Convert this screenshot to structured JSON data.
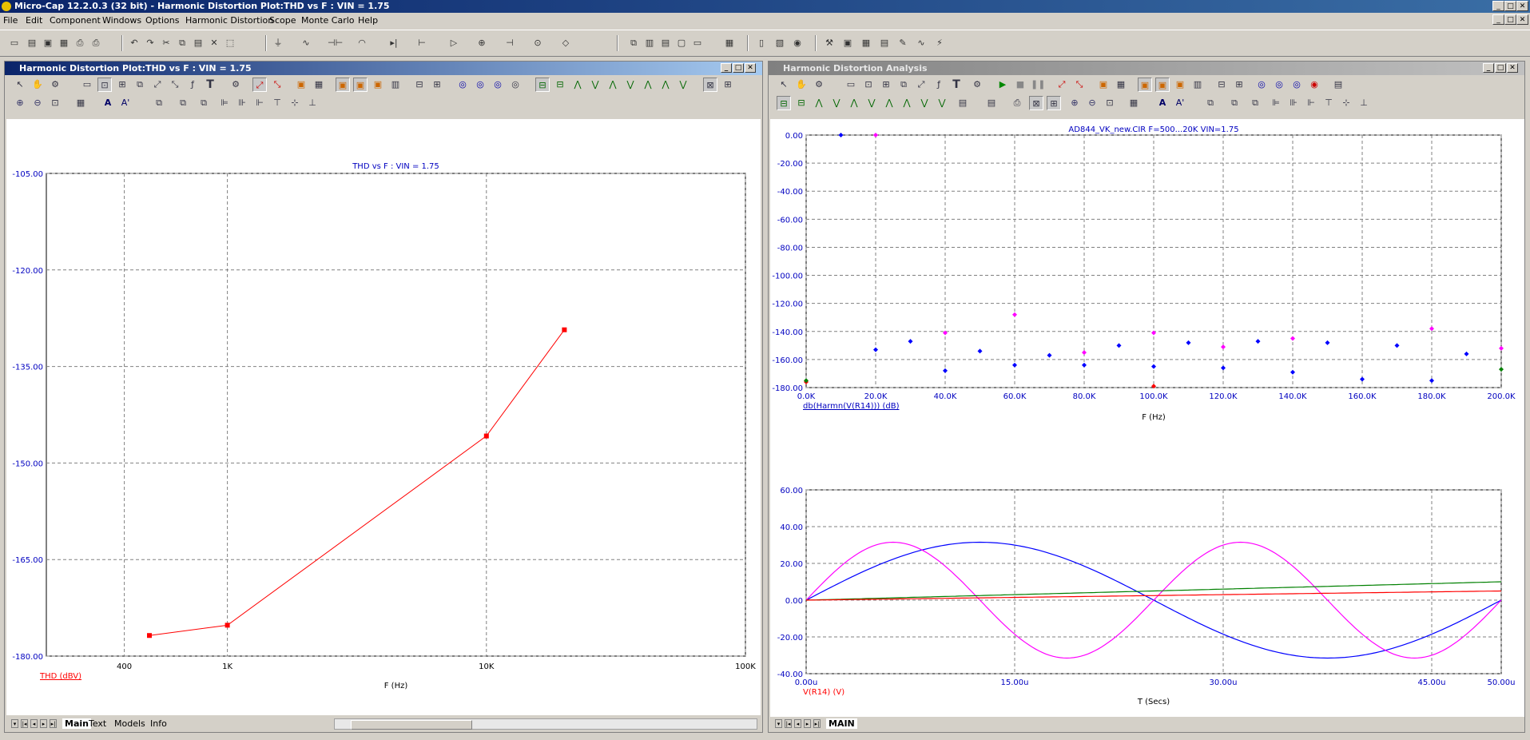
{
  "app": {
    "title": "Micro-Cap 12.2.0.3 (32 bit) - Harmonic Distortion Plot:THD vs F : VIN = 1.75",
    "menu": [
      "File",
      "Edit",
      "Component",
      "Windows",
      "Options",
      "Harmonic Distortion",
      "Scope",
      "Monte Carlo",
      "Help"
    ]
  },
  "left_pane": {
    "title": "Harmonic Distortion Plot:THD vs F : VIN = 1.75",
    "plot_title": "THD vs F : VIN = 1.75",
    "y_label": "THD (dBV)",
    "x_label": "F (Hz)",
    "y_ticks": [
      "-105.00",
      "-120.00",
      "-135.00",
      "-150.00",
      "-165.00",
      "-180.00"
    ],
    "x_ticks": [
      "400",
      "1K",
      "10K",
      "100K"
    ],
    "tabs": [
      "Main",
      "Text",
      "Models",
      "Info"
    ]
  },
  "right_pane": {
    "title": "Harmonic Distortion Analysis",
    "top_title": "AD844_VK_new.CIR F=500...20K VIN=1.75",
    "top_y_ticks": [
      "0.00",
      "-20.00",
      "-40.00",
      "-60.00",
      "-80.00",
      "-100.00",
      "-120.00",
      "-140.00",
      "-160.00",
      "-180.00"
    ],
    "top_x_ticks": [
      "0.0K",
      "20.0K",
      "40.0K",
      "60.0K",
      "80.0K",
      "100.0K",
      "120.0K",
      "140.0K",
      "160.0K",
      "180.0K",
      "200.0K"
    ],
    "top_y_label": "db(Harmn(V(R14))) (dB)",
    "top_x_label": "F (Hz)",
    "bot_y_ticks": [
      "60.00",
      "40.00",
      "20.00",
      "0.00",
      "-20.00",
      "-40.00"
    ],
    "bot_x_ticks": [
      "0.00u",
      "15.00u",
      "30.00u",
      "45.00u",
      "50.00u"
    ],
    "bot_y_label": "V(R14) (V)",
    "bot_x_label": "T (Secs)",
    "tabs": [
      "MAIN"
    ]
  },
  "chart_data": [
    {
      "type": "line",
      "title": "THD vs F : VIN = 1.75",
      "xlabel": "F (Hz)",
      "ylabel": "THD (dBV)",
      "x_scale": "log",
      "xlim": [
        200,
        100000
      ],
      "ylim": [
        -180,
        -105
      ],
      "grid": true,
      "series": [
        {
          "name": "THD (dBV)",
          "color": "#ff0000",
          "x": [
            500,
            1000,
            10000,
            20000
          ],
          "y": [
            -176.8,
            -175.2,
            -145.8,
            -129.3
          ]
        }
      ]
    },
    {
      "type": "scatter",
      "title": "AD844_VK_new.CIR F=500...20K VIN=1.75",
      "xlabel": "F (Hz)",
      "ylabel": "db(Harmn(V(R14))) (dB)",
      "xlim": [
        0,
        200000
      ],
      "ylim": [
        -180,
        0
      ],
      "grid": true,
      "series": [
        {
          "color": "#0000ff",
          "x": [
            10000,
            20000,
            30000,
            40000,
            50000,
            60000,
            70000,
            80000,
            90000,
            100000,
            110000,
            120000,
            130000,
            140000,
            150000,
            160000,
            170000,
            180000,
            190000
          ],
          "y": [
            0,
            -153,
            -147,
            -168,
            -154,
            -164,
            -157,
            -164,
            -150,
            -165,
            -148,
            -166,
            -147,
            -169,
            -148,
            -174,
            -150,
            -175,
            -156
          ]
        },
        {
          "color": "#ff00ff",
          "x": [
            20000,
            40000,
            60000,
            80000,
            100000,
            120000,
            140000,
            180000,
            200000
          ],
          "y": [
            0,
            -141,
            -128,
            -155,
            -141,
            -151,
            -145,
            -138,
            -152
          ]
        },
        {
          "color": "#ff0000",
          "x": [
            0,
            100000
          ],
          "y": [
            -176,
            -179
          ]
        },
        {
          "color": "#008000",
          "x": [
            0,
            200000
          ],
          "y": [
            -175,
            -167
          ]
        }
      ]
    },
    {
      "type": "line",
      "xlabel": "T (Secs)",
      "ylabel": "V(R14) (V)",
      "xlim": [
        0,
        50
      ],
      "x_unit": "u",
      "ylim": [
        -40,
        60
      ],
      "grid": true,
      "series": [
        {
          "color": "#0000ff",
          "kind": "sine",
          "amp": 31.5,
          "cycles": 1
        },
        {
          "color": "#ff00ff",
          "kind": "sine",
          "amp": 31.5,
          "cycles": 2
        },
        {
          "color": "#008000",
          "kind": "ramp",
          "end": 10
        },
        {
          "color": "#ff0000",
          "kind": "ramp",
          "end": 5
        }
      ]
    }
  ]
}
